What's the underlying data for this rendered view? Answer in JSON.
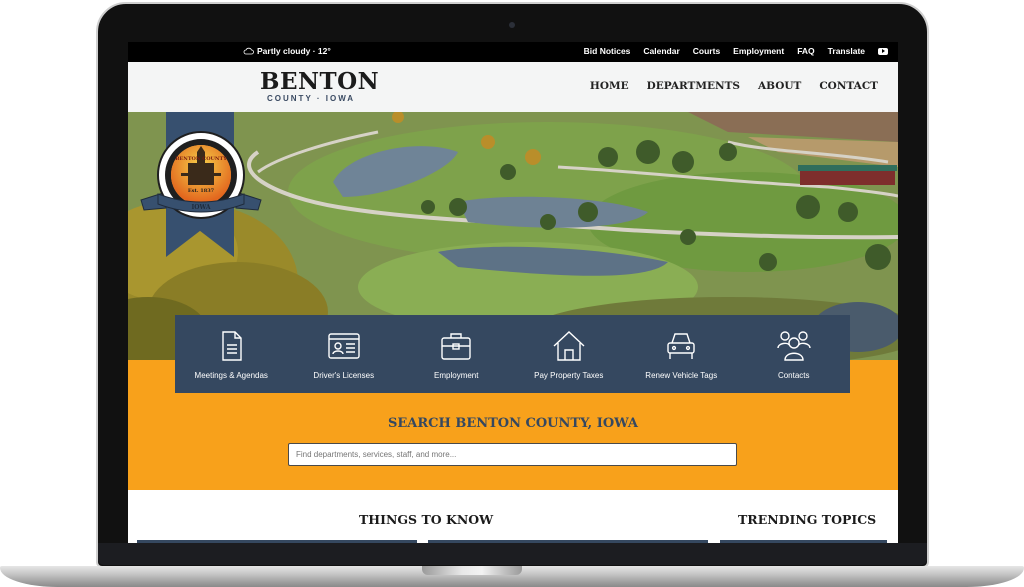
{
  "topbar": {
    "weather_icon": "cloud-icon",
    "weather": "Partly cloudy · 12°",
    "links": [
      "Bid Notices",
      "Calendar",
      "Courts",
      "Employment",
      "FAQ",
      "Translate"
    ],
    "social_icon": "youtube-icon"
  },
  "header": {
    "title": "BENTON",
    "subtitle": "COUNTY · IOWA",
    "logo": {
      "top_text": "BENTON COUNTY",
      "est": "Est. 1837",
      "banner": "IOWA"
    },
    "nav": [
      "HOME",
      "DEPARTMENTS",
      "ABOUT",
      "CONTACT"
    ]
  },
  "quick_links": [
    {
      "label": "Meetings & Agendas",
      "icon": "document-icon"
    },
    {
      "label": "Driver's Licenses",
      "icon": "id-card-icon"
    },
    {
      "label": "Employment",
      "icon": "briefcase-icon"
    },
    {
      "label": "Pay Property Taxes",
      "icon": "house-icon"
    },
    {
      "label": "Renew Vehicle Tags",
      "icon": "car-icon"
    },
    {
      "label": "Contacts",
      "icon": "people-icon"
    }
  ],
  "search": {
    "title": "SEARCH BENTON COUNTY, IOWA",
    "placeholder": "Find departments, services, staff, and more..."
  },
  "sections": {
    "things_to_know": "THINGS TO KNOW",
    "trending_topics": "TRENDING TOPICS"
  },
  "colors": {
    "brand_navy": "#354860",
    "accent_orange": "#f8a11b",
    "topbar": "#000000"
  }
}
